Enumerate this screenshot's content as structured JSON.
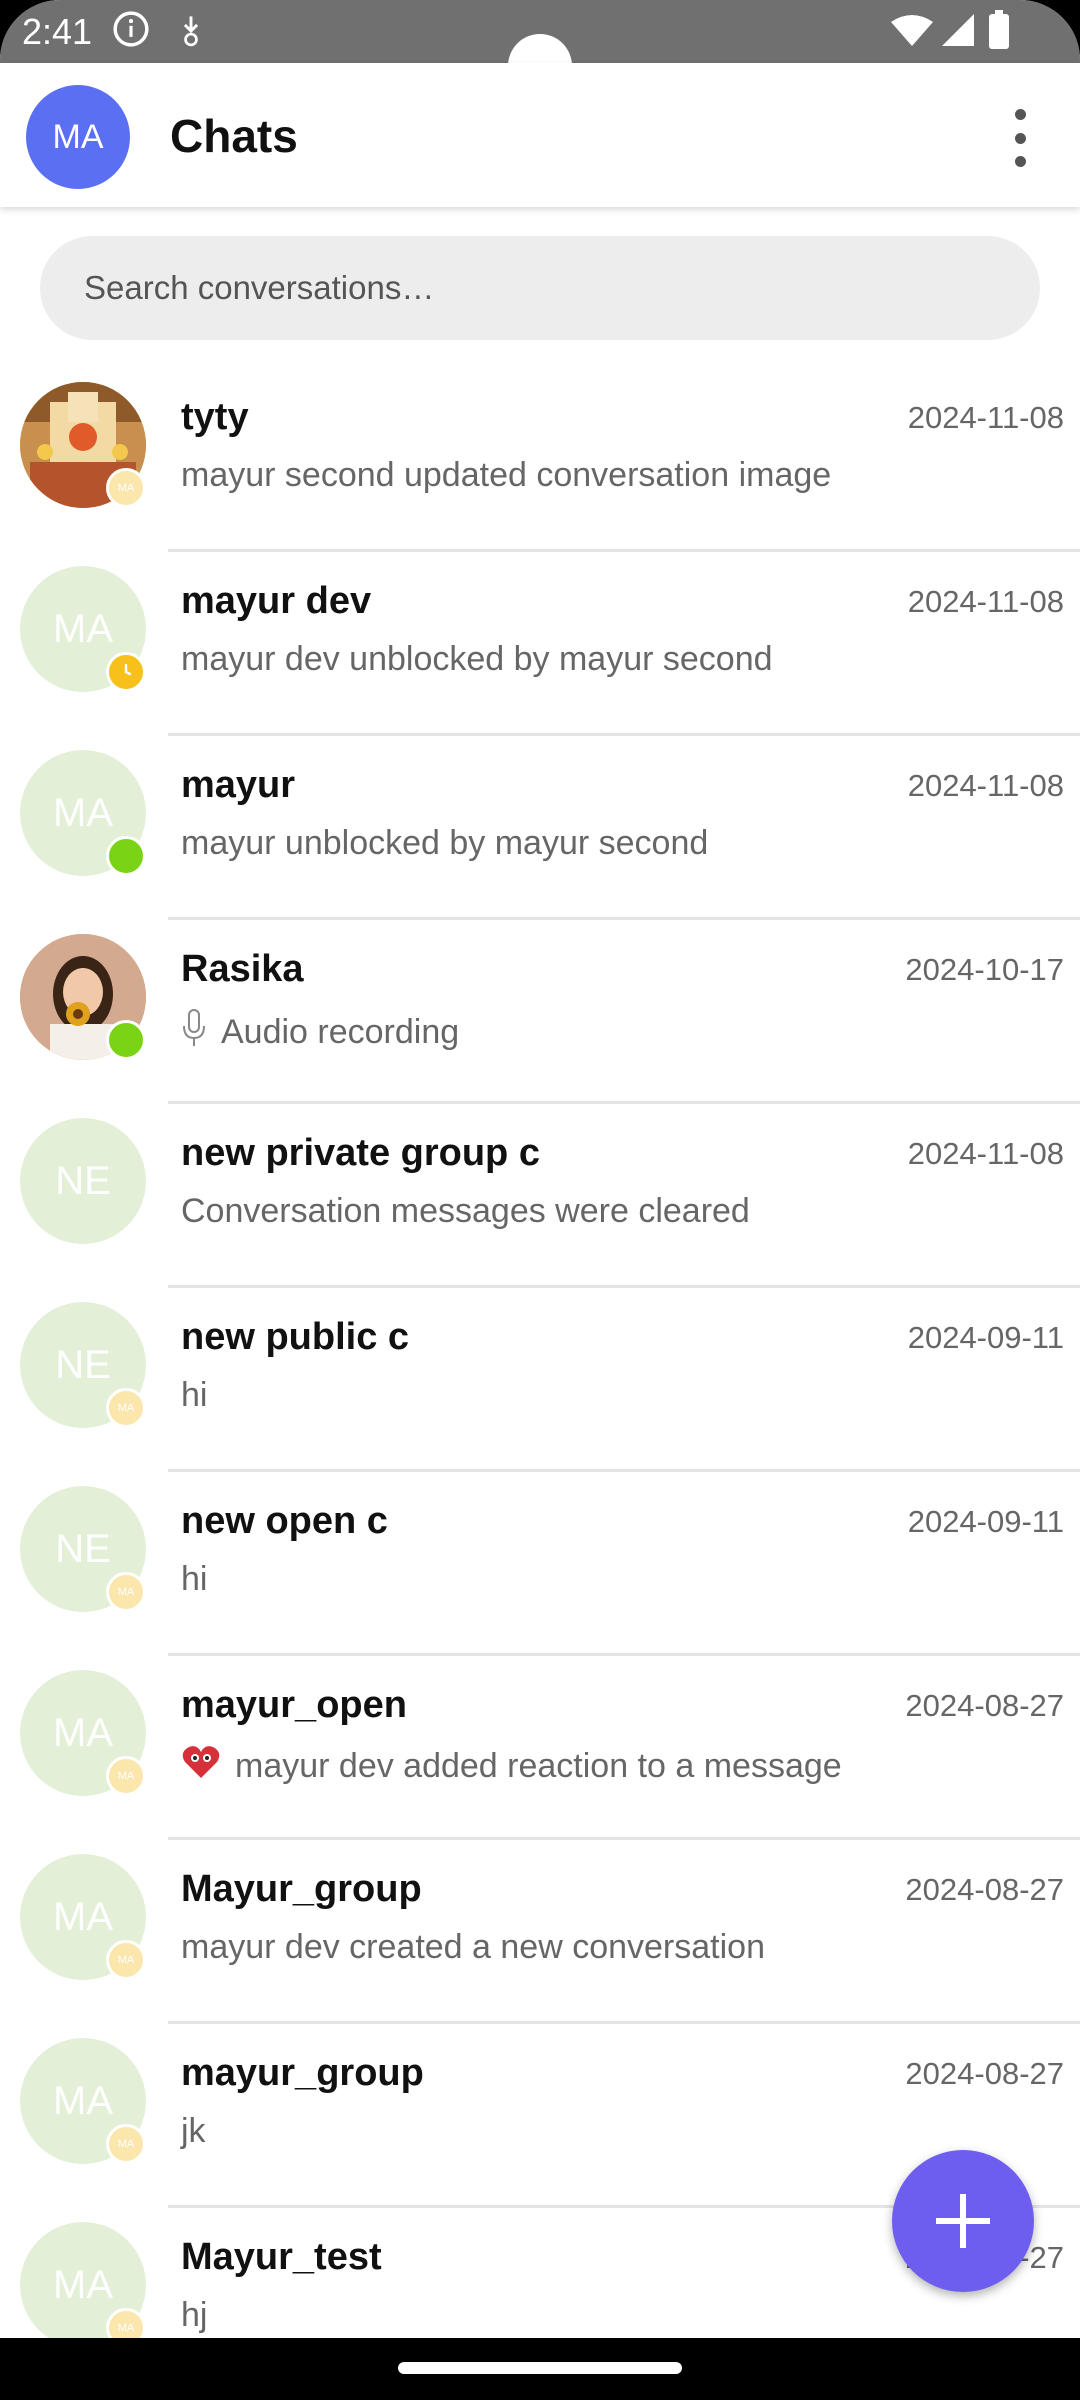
{
  "status_bar": {
    "time": "2:41"
  },
  "header": {
    "avatar_initials": "MA",
    "title": "Chats"
  },
  "search": {
    "placeholder": "Search conversations…",
    "value": ""
  },
  "conversations": [
    {
      "name": "tyty",
      "date": "2024-11-08",
      "preview": "mayur second  updated conversation image",
      "avatar": "photo-temple",
      "badge": "MA",
      "preview_icon": ""
    },
    {
      "name": "mayur dev",
      "date": "2024-11-08",
      "preview": "mayur dev unblocked by mayur second",
      "avatar": "MA",
      "badge": "away",
      "preview_icon": ""
    },
    {
      "name": "mayur",
      "date": "2024-11-08",
      "preview": "mayur unblocked by mayur second",
      "avatar": "MA",
      "badge": "online",
      "preview_icon": ""
    },
    {
      "name": "Rasika",
      "date": "2024-10-17",
      "preview": "Audio recording",
      "avatar": "photo-person",
      "badge": "online",
      "preview_icon": "mic-icon"
    },
    {
      "name": "new private group c",
      "date": "2024-11-08",
      "preview": "Conversation messages were cleared",
      "avatar": "NE",
      "badge": "",
      "preview_icon": ""
    },
    {
      "name": "new public c",
      "date": "2024-09-11",
      "preview": "hi",
      "avatar": "NE",
      "badge": "MA",
      "preview_icon": ""
    },
    {
      "name": "new open c",
      "date": "2024-09-11",
      "preview": "hi",
      "avatar": "NE",
      "badge": "MA",
      "preview_icon": ""
    },
    {
      "name": "mayur_open",
      "date": "2024-08-27",
      "preview": "mayur dev added reaction to a message",
      "avatar": "MA",
      "badge": "MA",
      "preview_icon": "heart-eyes-icon"
    },
    {
      "name": "Mayur_group",
      "date": "2024-08-27",
      "preview": "mayur dev created a new conversation",
      "avatar": "MA",
      "badge": "MA",
      "preview_icon": ""
    },
    {
      "name": "mayur_group",
      "date": "2024-08-27",
      "preview": "jk",
      "avatar": "MA",
      "badge": "MA",
      "preview_icon": ""
    },
    {
      "name": "Mayur_test",
      "date": "2024-08-27",
      "preview": "hj",
      "avatar": "MA",
      "badge": "MA",
      "preview_icon": ""
    }
  ],
  "colors": {
    "accent": "#5b6ff2",
    "fab": "#6e5ef0",
    "online": "#7ad415",
    "away": "#f7c01a",
    "avatar_bg": "#e3efd6"
  }
}
